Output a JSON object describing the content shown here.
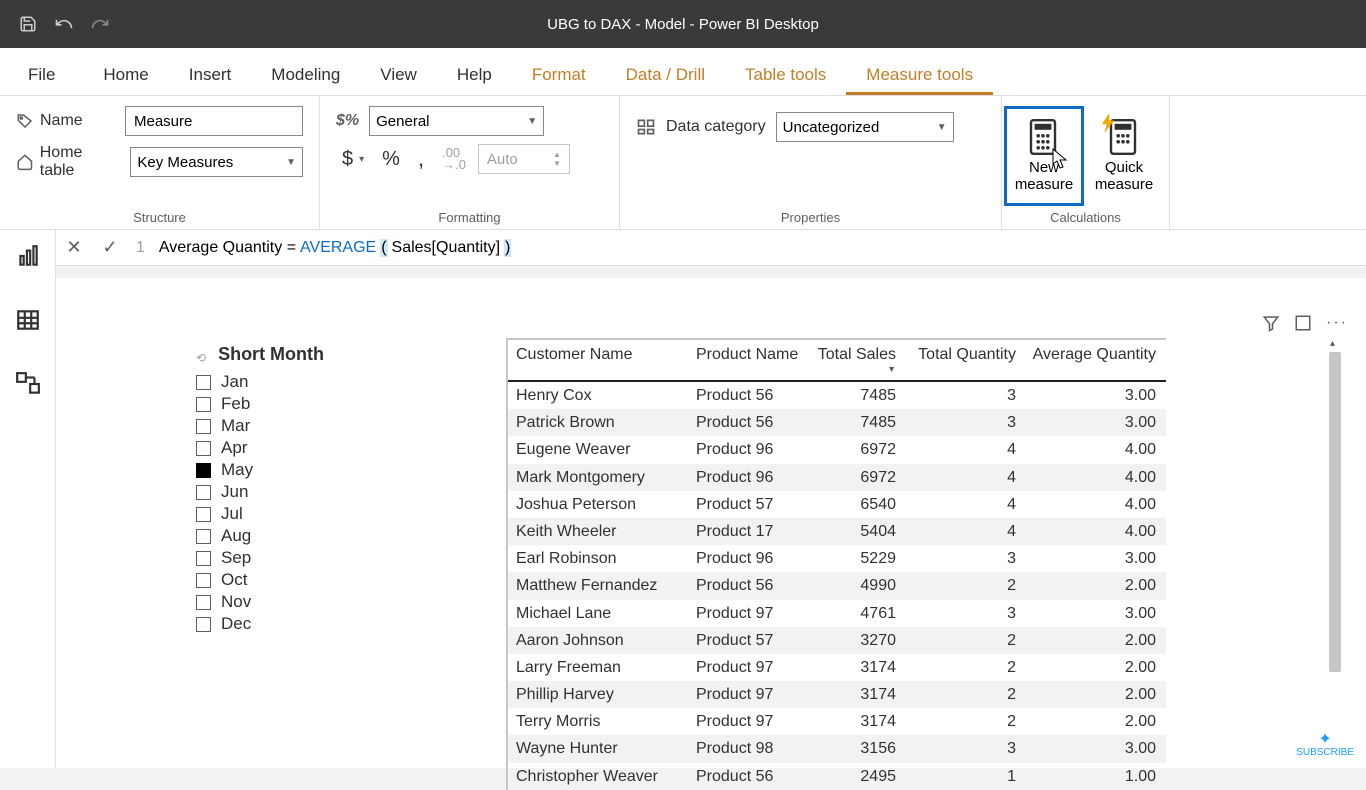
{
  "title": "UBG to DAX - Model - Power BI Desktop",
  "tabs": {
    "file": "File",
    "home": "Home",
    "insert": "Insert",
    "modeling": "Modeling",
    "view": "View",
    "help": "Help",
    "format": "Format",
    "datadrill": "Data / Drill",
    "tabletools": "Table tools",
    "measuretools": "Measure tools"
  },
  "structure": {
    "name_label": "Name",
    "name_value": "Measure",
    "home_label": "Home table",
    "home_value": "Key Measures",
    "group_label": "Structure"
  },
  "formatting": {
    "format_value": "General",
    "spin_placeholder": "Auto",
    "group_label": "Formatting"
  },
  "properties": {
    "datacat_label": "Data category",
    "datacat_value": "Uncategorized",
    "group_label": "Properties"
  },
  "calculations": {
    "new_label": "New\nmeasure",
    "quick_label": "Quick\nmeasure",
    "group_label": "Calculations"
  },
  "formula": {
    "line_no": "1",
    "pre": "Average Quantity = ",
    "func": "AVERAGE",
    "args": " Sales[Quantity] "
  },
  "slicer": {
    "title": "Short Month",
    "items": [
      {
        "label": "Jan",
        "checked": false
      },
      {
        "label": "Feb",
        "checked": false
      },
      {
        "label": "Mar",
        "checked": false
      },
      {
        "label": "Apr",
        "checked": false
      },
      {
        "label": "May",
        "checked": true
      },
      {
        "label": "Jun",
        "checked": false
      },
      {
        "label": "Jul",
        "checked": false
      },
      {
        "label": "Aug",
        "checked": false
      },
      {
        "label": "Sep",
        "checked": false
      },
      {
        "label": "Oct",
        "checked": false
      },
      {
        "label": "Nov",
        "checked": false
      },
      {
        "label": "Dec",
        "checked": false
      }
    ]
  },
  "table": {
    "headers": {
      "customer": "Customer Name",
      "product": "Product Name",
      "sales": "Total Sales",
      "qty": "Total Quantity",
      "avg": "Average Quantity"
    },
    "rows": [
      {
        "customer": "Henry Cox",
        "product": "Product 56",
        "sales": "7485",
        "qty": "3",
        "avg": "3.00"
      },
      {
        "customer": "Patrick Brown",
        "product": "Product 56",
        "sales": "7485",
        "qty": "3",
        "avg": "3.00"
      },
      {
        "customer": "Eugene Weaver",
        "product": "Product 96",
        "sales": "6972",
        "qty": "4",
        "avg": "4.00"
      },
      {
        "customer": "Mark Montgomery",
        "product": "Product 96",
        "sales": "6972",
        "qty": "4",
        "avg": "4.00"
      },
      {
        "customer": "Joshua Peterson",
        "product": "Product 57",
        "sales": "6540",
        "qty": "4",
        "avg": "4.00"
      },
      {
        "customer": "Keith Wheeler",
        "product": "Product 17",
        "sales": "5404",
        "qty": "4",
        "avg": "4.00"
      },
      {
        "customer": "Earl Robinson",
        "product": "Product 96",
        "sales": "5229",
        "qty": "3",
        "avg": "3.00"
      },
      {
        "customer": "Matthew Fernandez",
        "product": "Product 56",
        "sales": "4990",
        "qty": "2",
        "avg": "2.00"
      },
      {
        "customer": "Michael Lane",
        "product": "Product 97",
        "sales": "4761",
        "qty": "3",
        "avg": "3.00"
      },
      {
        "customer": "Aaron Johnson",
        "product": "Product 57",
        "sales": "3270",
        "qty": "2",
        "avg": "2.00"
      },
      {
        "customer": "Larry Freeman",
        "product": "Product 97",
        "sales": "3174",
        "qty": "2",
        "avg": "2.00"
      },
      {
        "customer": "Phillip Harvey",
        "product": "Product 97",
        "sales": "3174",
        "qty": "2",
        "avg": "2.00"
      },
      {
        "customer": "Terry Morris",
        "product": "Product 97",
        "sales": "3174",
        "qty": "2",
        "avg": "2.00"
      },
      {
        "customer": "Wayne Hunter",
        "product": "Product 98",
        "sales": "3156",
        "qty": "3",
        "avg": "3.00"
      },
      {
        "customer": "Christopher Weaver",
        "product": "Product 56",
        "sales": "2495",
        "qty": "1",
        "avg": "1.00"
      }
    ]
  },
  "subscribe": "SUBSCRIBE"
}
